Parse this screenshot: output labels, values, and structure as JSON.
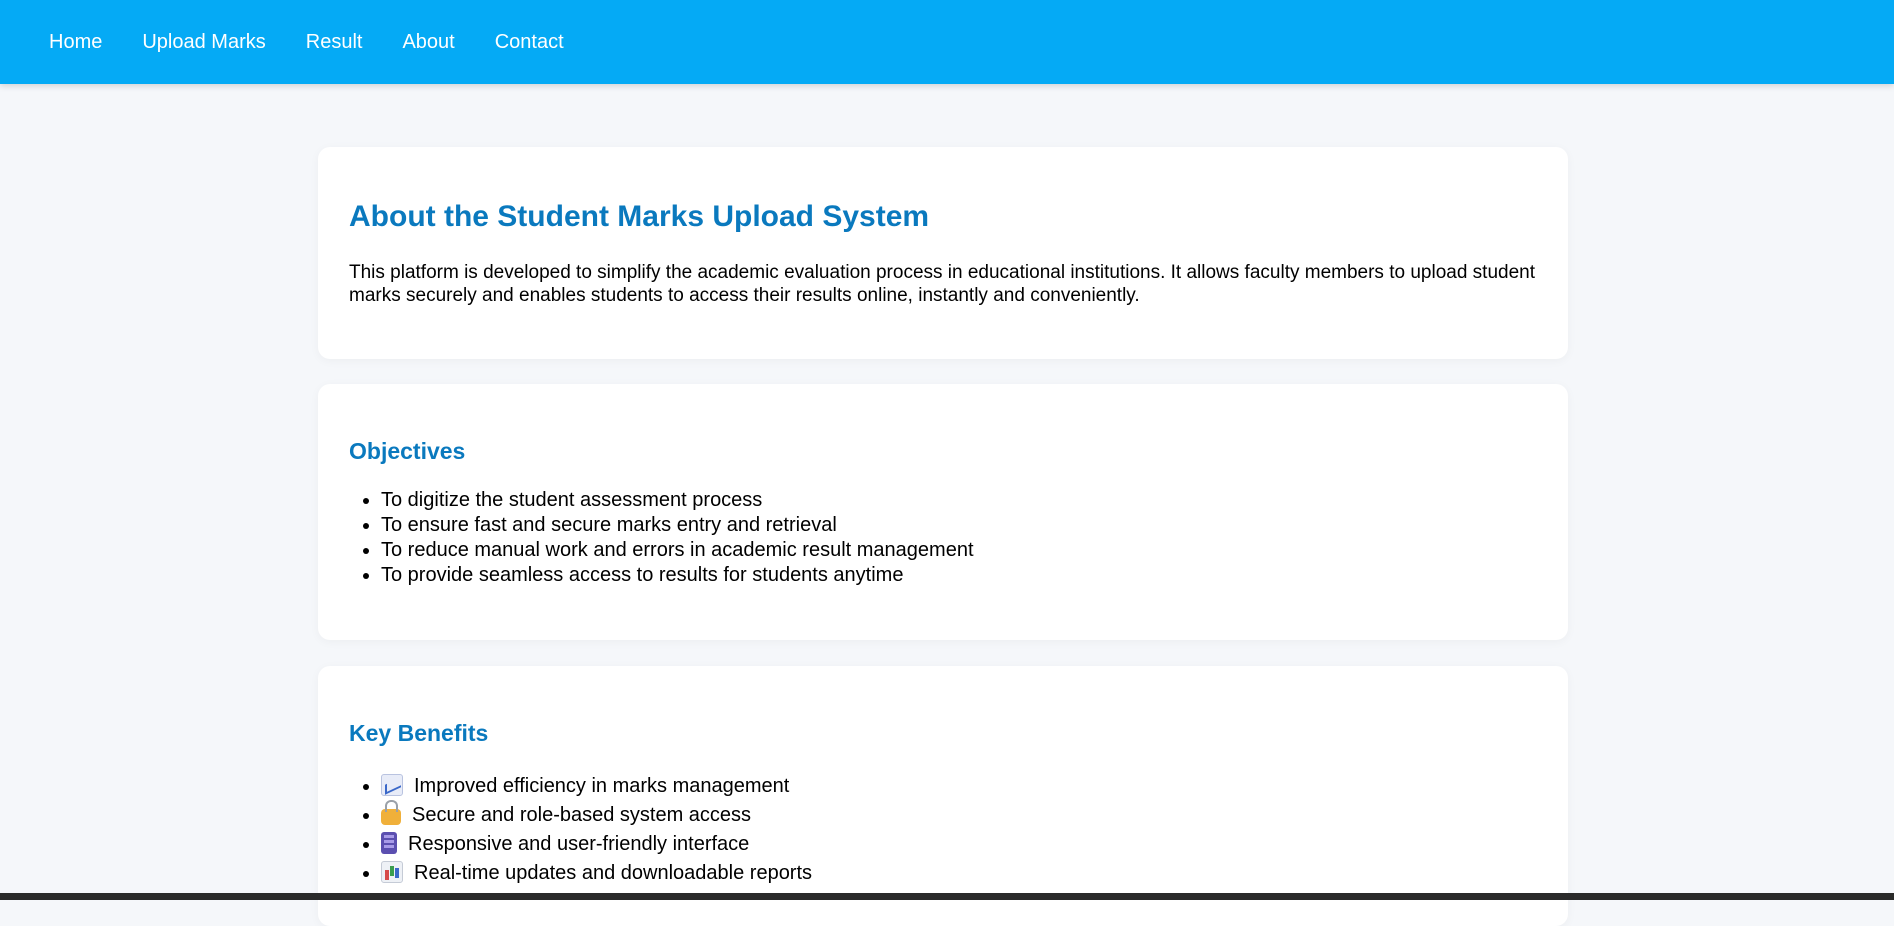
{
  "nav": {
    "items": [
      {
        "label": "Home"
      },
      {
        "label": "Upload Marks"
      },
      {
        "label": "Result"
      },
      {
        "label": "About"
      },
      {
        "label": "Contact"
      }
    ]
  },
  "about": {
    "title": "About the Student Marks Upload System",
    "description": "This platform is developed to simplify the academic evaluation process in educational institutions. It allows faculty members to upload student marks securely and enables students to access their results online, instantly and conveniently."
  },
  "objectives": {
    "title": "Objectives",
    "items": [
      "To digitize the student assessment process",
      "To ensure fast and secure marks entry and retrieval",
      "To reduce manual work and errors in academic result management",
      "To provide seamless access to results for students anytime"
    ]
  },
  "benefits": {
    "title": "Key Benefits",
    "items": [
      {
        "icon": "chart-increasing-icon",
        "text": "Improved efficiency in marks management"
      },
      {
        "icon": "lock-icon",
        "text": "Secure and role-based system access"
      },
      {
        "icon": "mobile-phone-icon",
        "text": "Responsive and user-friendly interface"
      },
      {
        "icon": "bar-chart-icon",
        "text": "Real-time updates and downloadable reports"
      }
    ]
  },
  "colors": {
    "navbar": "#05aaf5",
    "heading": "#0a79be",
    "background": "#f5f7fa"
  }
}
